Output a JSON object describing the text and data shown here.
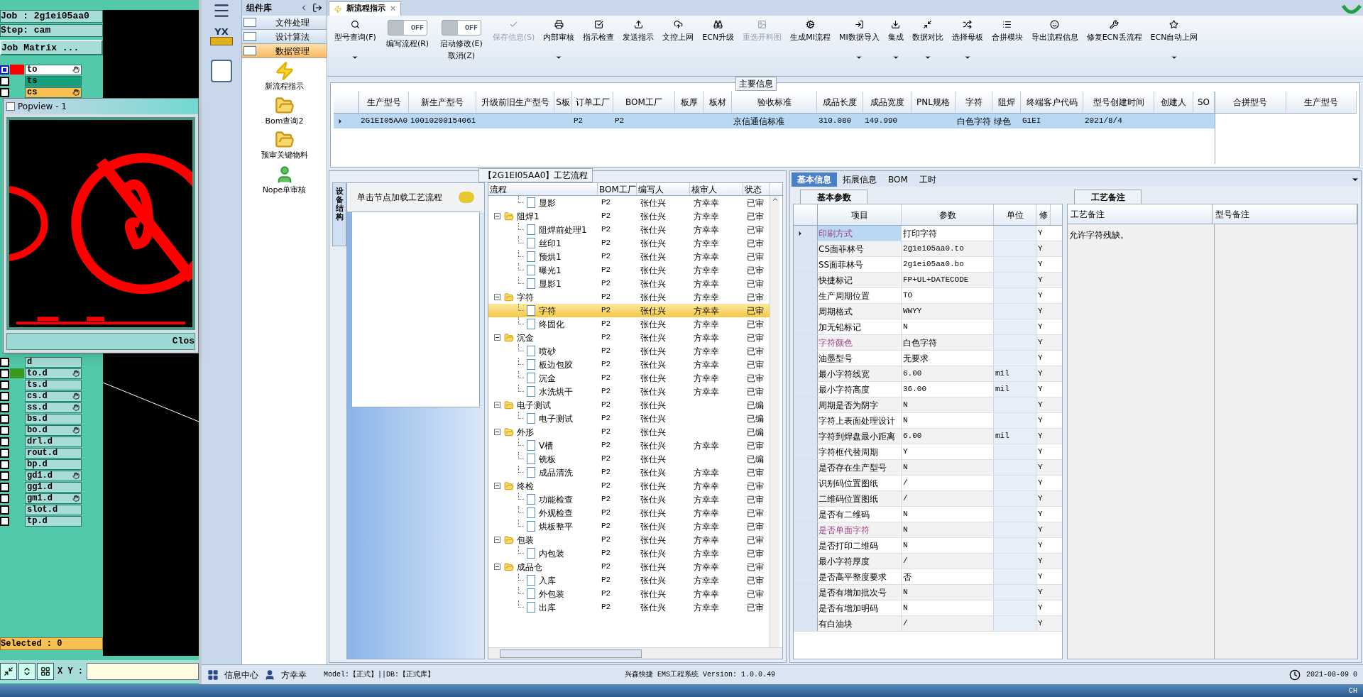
{
  "cam": {
    "job": "Job : 2g1ei05aa0",
    "step": "Step: cam",
    "matrix_button": "Job Matrix ...",
    "layers_top": [
      {
        "name": "to",
        "kind": "work",
        "color": "#ff0000",
        "hand": true,
        "selected": true
      },
      {
        "name": "ts",
        "kind": "board",
        "hand": false,
        "selected": false
      },
      {
        "name": "cs",
        "kind": "affected",
        "hand": true,
        "selected": false
      }
    ],
    "layers_bottom": [
      {
        "name": "d",
        "kind": "plain",
        "hand": false,
        "selected": false
      },
      {
        "name": "to.d",
        "kind": "plain",
        "color": "#3a9a20",
        "hand": true,
        "selected": false
      },
      {
        "name": "ts.d",
        "kind": "plain",
        "hand": false,
        "selected": false
      },
      {
        "name": "cs.d",
        "kind": "plain",
        "hand": true,
        "selected": false
      },
      {
        "name": "ss.d",
        "kind": "plain",
        "hand": true,
        "selected": false
      },
      {
        "name": "bs.d",
        "kind": "plain",
        "hand": false,
        "selected": false
      },
      {
        "name": "bo.d",
        "kind": "plain",
        "hand": true,
        "selected": false
      },
      {
        "name": "drl.d",
        "kind": "plain",
        "hand": false,
        "selected": false
      },
      {
        "name": "rout.d",
        "kind": "plain",
        "hand": false,
        "selected": false
      },
      {
        "name": "bp.d",
        "kind": "plain",
        "hand": false,
        "selected": false
      },
      {
        "name": "gd1.d",
        "kind": "plain",
        "hand": true,
        "selected": false
      },
      {
        "name": "gg1.d",
        "kind": "plain",
        "hand": false,
        "selected": false
      },
      {
        "name": "gm1.d",
        "kind": "plain",
        "hand": true,
        "selected": false
      },
      {
        "name": "slot.d",
        "kind": "plain",
        "hand": false,
        "selected": false
      },
      {
        "name": "tp.d",
        "kind": "plain",
        "hand": false,
        "selected": false
      }
    ],
    "selected_count": "Selected : 0",
    "xy_label": "X Y :",
    "popview": {
      "title": "Popview - 1",
      "close_button": "Clos"
    }
  },
  "nav": {
    "logo": "YX",
    "panel_title": "组件库",
    "sections": [
      {
        "label": "文件处理",
        "selected": false
      },
      {
        "label": "设计算法",
        "selected": false
      },
      {
        "label": "数据管理",
        "selected": true
      }
    ],
    "items": [
      "新流程指示",
      "Bom查询2",
      "预审关键物料",
      "Nope单审核"
    ],
    "footer": {
      "info": "信息中心",
      "user": "方幸幸"
    }
  },
  "tab": {
    "label": "新流程指示",
    "close": "×"
  },
  "toolbar": [
    {
      "kind": "button",
      "label": "型号查询(F)",
      "dropdown": true,
      "disabled": false
    },
    {
      "kind": "toggle",
      "state": "OFF",
      "on": false,
      "label": "编写流程(R)"
    },
    {
      "kind": "toggle",
      "state": "OFF",
      "on": false,
      "label": "启动修改(E)",
      "sub": "取消(Z)"
    },
    {
      "kind": "button",
      "label": "保存信息(S)",
      "dropdown": false,
      "disabled": true
    },
    {
      "kind": "button",
      "label": "内部审核",
      "dropdown": true,
      "disabled": false
    },
    {
      "kind": "button",
      "label": "指示检查",
      "dropdown": false,
      "disabled": false
    },
    {
      "kind": "button",
      "label": "发送指示",
      "dropdown": false,
      "disabled": false
    },
    {
      "kind": "button",
      "label": "文控上网",
      "dropdown": false,
      "disabled": false
    },
    {
      "kind": "button",
      "label": "ECN升级",
      "dropdown": false,
      "disabled": false
    },
    {
      "kind": "button",
      "label": "重选开料图",
      "dropdown": false,
      "disabled": true
    },
    {
      "kind": "button",
      "label": "生成MI流程",
      "dropdown": false,
      "disabled": false
    },
    {
      "kind": "button",
      "label": "MI数据导入",
      "dropdown": true,
      "disabled": false
    },
    {
      "kind": "button",
      "label": "集成",
      "dropdown": true,
      "disabled": false
    },
    {
      "kind": "button",
      "label": "数据对比",
      "dropdown": true,
      "disabled": false
    },
    {
      "kind": "button",
      "label": "选择母板",
      "dropdown": true,
      "disabled": false
    },
    {
      "kind": "button",
      "label": "合拼模块",
      "dropdown": false,
      "disabled": false
    },
    {
      "kind": "button",
      "label": "导出流程信息",
      "dropdown": false,
      "disabled": false
    },
    {
      "kind": "button",
      "label": "修复ECN丢流程",
      "dropdown": false,
      "disabled": false
    },
    {
      "kind": "button",
      "label": "ECN自动上网",
      "dropdown": true,
      "disabled": false
    }
  ],
  "main_info": {
    "title": "主要信息",
    "columns": [
      "生产型号",
      "新生产型号",
      "升级前旧生产型号",
      "S板",
      "订单工厂",
      "BOM工厂",
      "板厚",
      "板材",
      "验收标准",
      "成品长度",
      "成品宽度",
      "PNL规格",
      "字符",
      "阻焊",
      "终端客户代码",
      "型号创建时间",
      "创建人",
      "SO"
    ],
    "rows": [
      {
        "selected": true,
        "cells": [
          "2G1EI05AA0",
          "10010200154061",
          null,
          null,
          "P2",
          "P2",
          null,
          null,
          "京信通信标准",
          "310.080",
          "149.990",
          null,
          "白色字符",
          "绿色",
          "G1EI",
          "2021/8/4",
          null,
          null
        ]
      }
    ],
    "side_columns": [
      "合拼型号",
      "生产型号"
    ]
  },
  "process": {
    "title": "【2G1EI05AA0】工艺流程",
    "side_tab": "设备结构",
    "hint": "单击节点加载工艺流程",
    "columns": [
      "流程",
      "BOM工厂",
      "编写人",
      "核审人",
      "状态"
    ],
    "nodes": [
      {
        "kind": "leaf",
        "label": "显影",
        "bom": "P2",
        "writer": "张仕兴",
        "reviewer": "方幸幸",
        "status": "已审",
        "selected": false
      },
      {
        "kind": "group",
        "label": "阻焊1",
        "bom": "P2",
        "writer": "张仕兴",
        "reviewer": "方幸幸",
        "status": "已审",
        "selected": false,
        "children": [
          {
            "kind": "leaf",
            "label": "阻焊前处理1",
            "bom": "P2",
            "writer": "张仕兴",
            "reviewer": "方幸幸",
            "status": "已审",
            "selected": false
          },
          {
            "kind": "leaf",
            "label": "丝印1",
            "bom": "P2",
            "writer": "张仕兴",
            "reviewer": "方幸幸",
            "status": "已审",
            "selected": false
          },
          {
            "kind": "leaf",
            "label": "预烘1",
            "bom": "P2",
            "writer": "张仕兴",
            "reviewer": "方幸幸",
            "status": "已审",
            "selected": false
          },
          {
            "kind": "leaf",
            "label": "曝光1",
            "bom": "P2",
            "writer": "张仕兴",
            "reviewer": "方幸幸",
            "status": "已审",
            "selected": false
          },
          {
            "kind": "leaf",
            "label": "显影1",
            "bom": "P2",
            "writer": "张仕兴",
            "reviewer": "方幸幸",
            "status": "已审",
            "selected": false
          }
        ]
      },
      {
        "kind": "group",
        "label": "字符",
        "bom": "P2",
        "writer": "张仕兴",
        "reviewer": "方幸幸",
        "status": "已审",
        "selected": false,
        "children": [
          {
            "kind": "leaf",
            "label": "字符",
            "bom": "P2",
            "writer": "张仕兴",
            "reviewer": "方幸幸",
            "status": "已审",
            "selected": true
          },
          {
            "kind": "leaf",
            "label": "终固化",
            "bom": "P2",
            "writer": "张仕兴",
            "reviewer": "方幸幸",
            "status": "已审",
            "selected": false
          }
        ]
      },
      {
        "kind": "group",
        "label": "沉金",
        "bom": "P2",
        "writer": "张仕兴",
        "reviewer": "方幸幸",
        "status": "已审",
        "selected": false,
        "children": [
          {
            "kind": "leaf",
            "label": "喷砂",
            "bom": "P2",
            "writer": "张仕兴",
            "reviewer": "方幸幸",
            "status": "已审",
            "selected": false
          },
          {
            "kind": "leaf",
            "label": "板边包胶",
            "bom": "P2",
            "writer": "张仕兴",
            "reviewer": "方幸幸",
            "status": "已审",
            "selected": false
          },
          {
            "kind": "leaf",
            "label": "沉金",
            "bom": "P2",
            "writer": "张仕兴",
            "reviewer": "方幸幸",
            "status": "已审",
            "selected": false
          },
          {
            "kind": "leaf",
            "label": "水洗烘干",
            "bom": "P2",
            "writer": "张仕兴",
            "reviewer": "方幸幸",
            "status": "已审",
            "selected": false
          }
        ]
      },
      {
        "kind": "group",
        "label": "电子测试",
        "bom": "P2",
        "writer": "张仕兴",
        "status": "已编",
        "selected": false,
        "children": [
          {
            "kind": "leaf",
            "label": "电子测试",
            "bom": "P2",
            "writer": "张仕兴",
            "status": "已编",
            "selected": false
          }
        ]
      },
      {
        "kind": "group",
        "label": "外形",
        "bom": "P2",
        "writer": "张仕兴",
        "status": "已编",
        "selected": false,
        "children": [
          {
            "kind": "leaf",
            "label": "V槽",
            "bom": "P2",
            "writer": "张仕兴",
            "reviewer": "方幸幸",
            "status": "已审",
            "selected": false
          },
          {
            "kind": "leaf",
            "label": "铣板",
            "bom": "P2",
            "writer": "张仕兴",
            "status": "已编",
            "selected": false
          },
          {
            "kind": "leaf",
            "label": "成品清洗",
            "bom": "P2",
            "writer": "张仕兴",
            "reviewer": "方幸幸",
            "status": "已审",
            "selected": false
          }
        ]
      },
      {
        "kind": "group",
        "label": "终检",
        "bom": "P2",
        "writer": "张仕兴",
        "reviewer": "方幸幸",
        "status": "已审",
        "selected": false,
        "children": [
          {
            "kind": "leaf",
            "label": "功能检查",
            "bom": "P2",
            "writer": "张仕兴",
            "reviewer": "方幸幸",
            "status": "已审",
            "selected": false
          },
          {
            "kind": "leaf",
            "label": "外观检查",
            "bom": "P2",
            "writer": "张仕兴",
            "reviewer": "方幸幸",
            "status": "已审",
            "selected": false
          },
          {
            "kind": "leaf",
            "label": "烘板整平",
            "bom": "P2",
            "writer": "张仕兴",
            "reviewer": "方幸幸",
            "status": "已审",
            "selected": false
          }
        ]
      },
      {
        "kind": "group",
        "label": "包装",
        "bom": "P2",
        "writer": "张仕兴",
        "reviewer": "方幸幸",
        "status": "已审",
        "selected": false,
        "children": [
          {
            "kind": "leaf",
            "label": "内包装",
            "bom": "P2",
            "writer": "张仕兴",
            "reviewer": "方幸幸",
            "status": "已审",
            "selected": false
          }
        ]
      },
      {
        "kind": "group",
        "label": "成品仓",
        "bom": "P2",
        "writer": "张仕兴",
        "reviewer": "方幸幸",
        "status": "已审",
        "selected": false,
        "children": [
          {
            "kind": "leaf",
            "label": "入库",
            "bom": "P2",
            "writer": "张仕兴",
            "reviewer": "方幸幸",
            "status": "已审",
            "selected": false
          },
          {
            "kind": "leaf",
            "label": "外包装",
            "bom": "P2",
            "writer": "张仕兴",
            "reviewer": "方幸幸",
            "status": "已审",
            "selected": false
          },
          {
            "kind": "leaf",
            "label": "出库",
            "bom": "P2",
            "writer": "张仕兴",
            "reviewer": "方幸幸",
            "status": "已审",
            "selected": false
          }
        ]
      }
    ]
  },
  "detail_tabs": [
    {
      "label": "基本信息",
      "selected": true
    },
    {
      "label": "拓展信息",
      "selected": false
    },
    {
      "label": "BOM",
      "selected": false
    },
    {
      "label": "工时",
      "selected": false
    }
  ],
  "params": {
    "tab": "基本参数",
    "columns": [
      "项目",
      "参数",
      "单位",
      "修"
    ],
    "rows": [
      {
        "item": "印刷方式",
        "param": "打印字符",
        "flagged": true,
        "selected": true,
        "mod": "Y"
      },
      {
        "item": "CS面菲林号",
        "param": "2g1ei05aa0.to",
        "flagged": false,
        "selected": false,
        "mod": "Y"
      },
      {
        "item": "SS面菲林号",
        "param": "2g1ei05aa0.bo",
        "flagged": false,
        "selected": false,
        "mod": "Y"
      },
      {
        "item": "快捷标记",
        "param": "FP+UL+DATECODE",
        "flagged": false,
        "selected": false,
        "mod": "Y"
      },
      {
        "item": "生产周期位置",
        "param": "TO",
        "flagged": false,
        "selected": false,
        "mod": "Y"
      },
      {
        "item": "周期格式",
        "param": "WWYY",
        "flagged": false,
        "selected": false,
        "mod": "Y"
      },
      {
        "item": "加无铅标记",
        "param": "N",
        "flagged": false,
        "selected": false,
        "mod": "Y"
      },
      {
        "item": "字符颜色",
        "param": "白色字符",
        "flagged": true,
        "selected": false,
        "mod": "Y"
      },
      {
        "item": "油墨型号",
        "param": "无要求",
        "flagged": false,
        "selected": false,
        "mod": "Y"
      },
      {
        "item": "最小字符线宽",
        "param": "6.00",
        "unit": "mil",
        "flagged": false,
        "selected": false,
        "mod": "Y"
      },
      {
        "item": "最小字符高度",
        "param": "36.00",
        "unit": "mil",
        "flagged": false,
        "selected": false,
        "mod": "Y"
      },
      {
        "item": "周期是否为阴字",
        "param": "N",
        "flagged": false,
        "selected": false,
        "mod": "Y"
      },
      {
        "item": "字符上表面处理设计",
        "param": "N",
        "flagged": false,
        "selected": false,
        "mod": "Y"
      },
      {
        "item": "字符到焊盘最小距离",
        "param": "6.00",
        "unit": "mil",
        "flagged": false,
        "selected": false,
        "mod": "Y"
      },
      {
        "item": "字符框代替周期",
        "param": "Y",
        "flagged": false,
        "selected": false,
        "mod": "Y"
      },
      {
        "item": "是否存在生产型号",
        "param": "N",
        "flagged": false,
        "selected": false,
        "mod": "Y"
      },
      {
        "item": "识别码位置图纸",
        "param": "/",
        "flagged": false,
        "selected": false,
        "mod": "Y"
      },
      {
        "item": "二维码位置图纸",
        "param": "/",
        "flagged": false,
        "selected": false,
        "mod": "Y"
      },
      {
        "item": "是否有二维码",
        "param": "N",
        "flagged": false,
        "selected": false,
        "mod": "Y"
      },
      {
        "item": "是否单面字符",
        "param": "N",
        "flagged": true,
        "selected": false,
        "mod": "Y"
      },
      {
        "item": "是否打印二维码",
        "param": "N",
        "flagged": false,
        "selected": false,
        "mod": "Y"
      },
      {
        "item": "最小字符厚度",
        "param": "/",
        "flagged": false,
        "selected": false,
        "mod": "Y"
      },
      {
        "item": "是否高平整度要求",
        "param": "否",
        "flagged": false,
        "selected": false,
        "mod": "Y"
      },
      {
        "item": "是否有增加批次号",
        "param": "N",
        "flagged": false,
        "selected": false,
        "mod": "Y"
      },
      {
        "item": "是否有增加明码",
        "param": "N",
        "flagged": false,
        "selected": false,
        "mod": "Y"
      },
      {
        "item": "有白油块",
        "param": "/",
        "flagged": false,
        "selected": false,
        "mod": "Y"
      }
    ]
  },
  "notes": {
    "tab": "工艺备注",
    "columns": [
      "工艺备注",
      "型号备注"
    ],
    "process_note": "允许字符残缺。"
  },
  "status_bar": {
    "model": "Model:【正式】||DB:【正式库】",
    "system": "兴森快捷 EMS工程系统 Version: 1.0.0.49",
    "datetime": "2021-08-09 0"
  },
  "taskbar": {
    "language": "CH"
  }
}
